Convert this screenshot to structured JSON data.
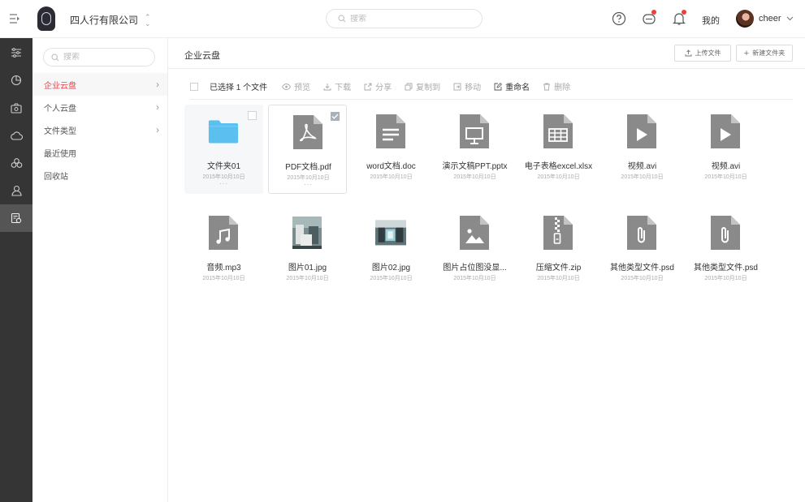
{
  "header": {
    "company": "四人行有限公司",
    "search_placeholder": "搜索",
    "mine_label": "我的",
    "username": "cheer"
  },
  "sidebar": {
    "search_placeholder": "搜索",
    "items": [
      {
        "label": "企业云盘",
        "active": true,
        "has_children": true
      },
      {
        "label": "个人云盘",
        "active": false,
        "has_children": true
      },
      {
        "label": "文件类型",
        "active": false,
        "has_children": true
      },
      {
        "label": "最近使用",
        "active": false,
        "has_children": false
      },
      {
        "label": "回收站",
        "active": false,
        "has_children": false
      }
    ]
  },
  "main": {
    "title": "企业云盘",
    "upload_label": "上传文件",
    "new_folder_label": "新建文件夹",
    "toolbar": {
      "selected": "已选择 1 个文件",
      "actions": [
        "预览",
        "下载",
        "分享",
        "复制到",
        "移动",
        "重命名",
        "删除"
      ]
    },
    "files": [
      {
        "name": "文件夹01",
        "date": "2015年10月10日",
        "type": "folder"
      },
      {
        "name": "PDF文档.pdf",
        "date": "2015年10月10日",
        "type": "pdf"
      },
      {
        "name": "word文档.doc",
        "date": "2015年10月10日",
        "type": "doc"
      },
      {
        "name": "演示文稿PPT.pptx",
        "date": "2015年10月10日",
        "type": "ppt"
      },
      {
        "name": "电子表格excel.xlsx",
        "date": "2015年10月10日",
        "type": "xls"
      },
      {
        "name": "视频.avi",
        "date": "2015年10月10日",
        "type": "video"
      },
      {
        "name": "视频.avi",
        "date": "2015年10月10日",
        "type": "video"
      },
      {
        "name": "音频.mp3",
        "date": "2015年10月10日",
        "type": "audio"
      },
      {
        "name": "图片01.jpg",
        "date": "2015年10月10日",
        "type": "photo1"
      },
      {
        "name": "图片02.jpg",
        "date": "2015年10月10日",
        "type": "photo2"
      },
      {
        "name": "图片占位图没显...",
        "date": "2015年10月10日",
        "type": "image"
      },
      {
        "name": "压缩文件.zip",
        "date": "2015年10月10日",
        "type": "zip"
      },
      {
        "name": "其他类型文件.psd",
        "date": "2015年10月10日",
        "type": "other"
      },
      {
        "name": "其他类型文件.psd",
        "date": "2015年10月10日",
        "type": "other"
      }
    ]
  },
  "colors": {
    "accent": "#e8434b",
    "rail_bg": "#353535",
    "file_icon": "#8a8a8a",
    "folder_icon": "#5bc0f0"
  }
}
